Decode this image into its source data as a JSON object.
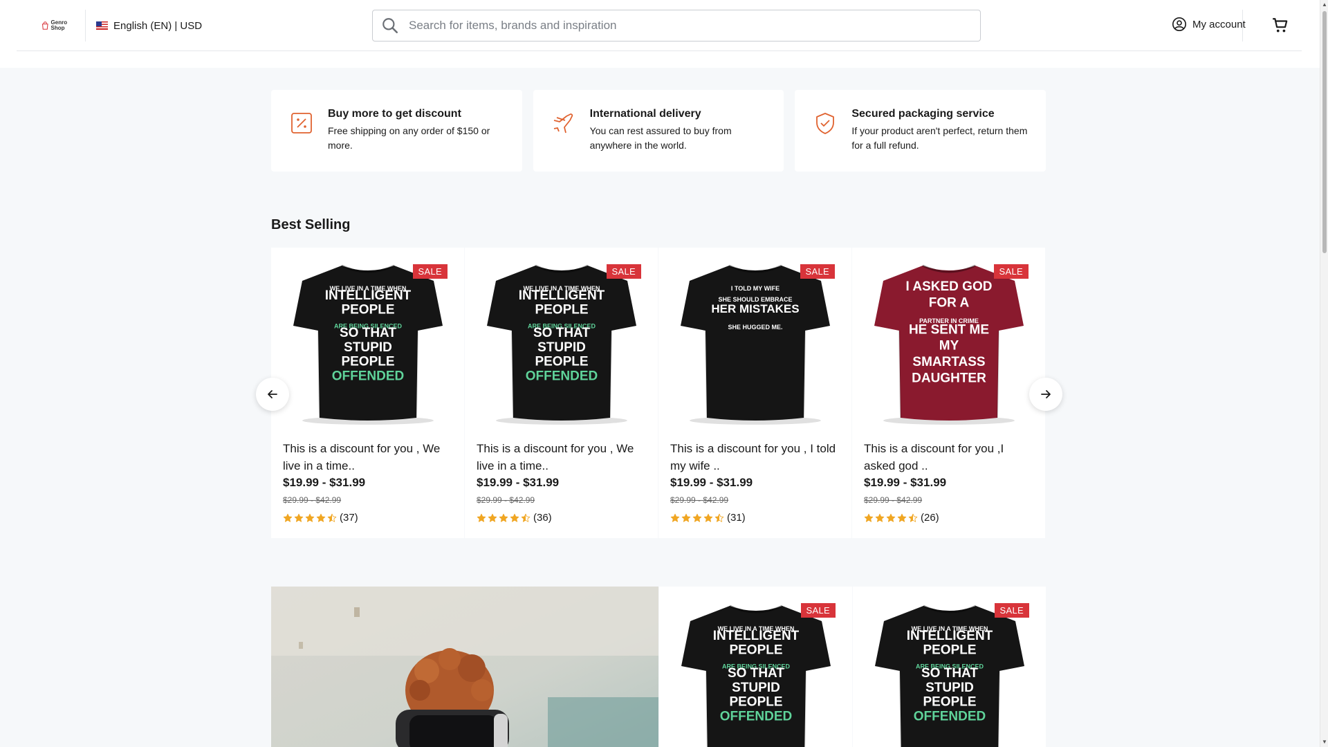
{
  "header": {
    "logo_text": "Genro Shop",
    "locale": "English (EN) | USD",
    "search_placeholder": "Search for items, brands and inspiration",
    "account_label": "My account"
  },
  "features": [
    {
      "icon": "discount-tag-icon",
      "title": "Buy more to get discount",
      "desc": "Free shipping on any order of $150 or more."
    },
    {
      "icon": "airplane-icon",
      "title": "International delivery",
      "desc": "You can rest assured to buy from anywhere in the world."
    },
    {
      "icon": "shield-check-icon",
      "title": "Secured packaging service",
      "desc": "If your product aren't perfect, return them for a full refund."
    }
  ],
  "best_selling": {
    "title": "Best Selling",
    "products": [
      {
        "badge": "SALE",
        "shirt_color": "#151515",
        "shirt_text": [
          "WE LIVE IN A TIME WHEN",
          "INTELLIGENT",
          "PEOPLE",
          "ARE BEING SILENCED",
          "SO THAT",
          "STUPID",
          "PEOPLE",
          "OFFENDED"
        ],
        "title": "This is a discount for you , We live in a time..",
        "price": "$19.99 - $31.99",
        "old_price": "$29.99 - $42.99",
        "rating": 4.5,
        "reviews": "(37)"
      },
      {
        "badge": "SALE",
        "shirt_color": "#151515",
        "shirt_text": [
          "WE LIVE IN A TIME WHEN",
          "INTELLIGENT",
          "PEOPLE",
          "ARE BEING SILENCED",
          "SO THAT",
          "STUPID",
          "PEOPLE",
          "OFFENDED"
        ],
        "title": "This is a discount for you , We live in a time..",
        "price": "$19.99 - $31.99",
        "old_price": "$29.99 - $42.99",
        "rating": 4.5,
        "reviews": "(36)"
      },
      {
        "badge": "SALE",
        "shirt_color": "#151515",
        "shirt_text": [
          "I TOLD MY WIFE",
          "SHE SHOULD EMBRACE",
          "HER MISTAKES",
          "SHE HUGGED ME."
        ],
        "title": "This is a discount for you , I told my wife ..",
        "price": "$19.99 - $31.99",
        "old_price": "$29.99 - $42.99",
        "rating": 4.5,
        "reviews": "(31)"
      },
      {
        "badge": "SALE",
        "shirt_color": "#8a1a2e",
        "shirt_text": [
          "I ASKED GOD",
          "FOR A",
          "PARTNER IN CRIME",
          "HE SENT ME",
          "MY",
          "SMARTASS",
          "DAUGHTER"
        ],
        "title": "This is a discount for you ,I asked god ..",
        "price": "$19.99 - $31.99",
        "old_price": "$29.99 - $42.99",
        "rating": 4.5,
        "reviews": "(26)"
      }
    ]
  },
  "bottom_products": [
    {
      "badge": "SALE",
      "shirt_color": "#151515",
      "shirt_text": [
        "WE LIVE IN A TIME WHEN",
        "INTELLIGENT",
        "PEOPLE",
        "ARE BEING SILENCED",
        "SO THAT",
        "STUPID",
        "PEOPLE",
        "OFFENDED"
      ]
    },
    {
      "badge": "SALE",
      "shirt_color": "#151515",
      "shirt_text": [
        "WE LIVE IN A TIME WHEN",
        "INTELLIGENT",
        "PEOPLE",
        "ARE BEING SILENCED",
        "SO THAT",
        "STUPID",
        "PEOPLE",
        "OFFENDED"
      ]
    }
  ],
  "colors": {
    "accent": "#e0622f",
    "sale": "#d8343a",
    "star": "#f0a623"
  }
}
